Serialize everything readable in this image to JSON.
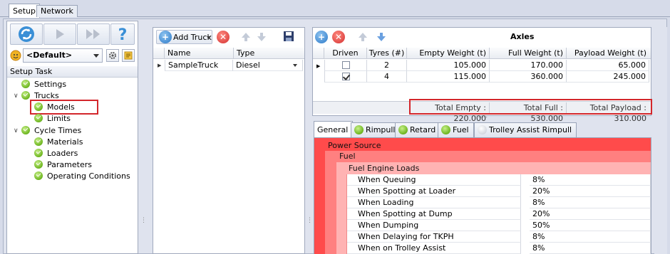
{
  "top_tabs": [
    "Setup",
    "Network"
  ],
  "profile": {
    "selected": "<Default>"
  },
  "setup_task": {
    "header": "Setup Task",
    "items": [
      {
        "label": "Settings",
        "level": 1
      },
      {
        "label": "Trucks",
        "level": 0,
        "expanded": true
      },
      {
        "label": "Models",
        "level": 1,
        "selected": true
      },
      {
        "label": "Limits",
        "level": 1
      },
      {
        "label": "Cycle Times",
        "level": 0,
        "expanded": true
      },
      {
        "label": "Materials",
        "level": 1
      },
      {
        "label": "Loaders",
        "level": 1
      },
      {
        "label": "Parameters",
        "level": 1
      },
      {
        "label": "Operating Conditions",
        "level": 1
      }
    ]
  },
  "trucks": {
    "add_label": "Add Truck",
    "columns": [
      "Name",
      "Type"
    ],
    "rows": [
      {
        "name": "SampleTruck",
        "type": "Diesel"
      }
    ]
  },
  "axles": {
    "title": "Axles",
    "columns": [
      "Driven",
      "Tyres (#)",
      "Empty Weight (t)",
      "Full Weight (t)",
      "Payload Weight (t)"
    ],
    "rows": [
      {
        "driven": false,
        "tyres": "2",
        "empty": "105.000",
        "full": "170.000",
        "payload": "65.000"
      },
      {
        "driven": true,
        "tyres": "4",
        "empty": "115.000",
        "full": "360.000",
        "payload": "245.000"
      }
    ],
    "totals": {
      "empty": "Total Empty : 220.000",
      "full": "Total Full : 530.000",
      "payload": "Total Payload : 310.000"
    }
  },
  "detail_tabs": [
    "General",
    "Rimpull",
    "Retard",
    "Fuel",
    "Trolley Assist Rimpull"
  ],
  "properties": {
    "group1": "Power Source",
    "group2": "Fuel",
    "group3": "Fuel Engine Loads",
    "rows": [
      {
        "label": "When Queuing",
        "value": "8%"
      },
      {
        "label": "When Spotting at Loader",
        "value": "20%"
      },
      {
        "label": "When Loading",
        "value": "8%"
      },
      {
        "label": "When Spotting at Dump",
        "value": "20%"
      },
      {
        "label": "When Dumping",
        "value": "50%"
      },
      {
        "label": "When Delaying for TKPH",
        "value": "8%"
      },
      {
        "label": "When on Trolley Assist",
        "value": "8%"
      }
    ]
  },
  "colors": {
    "accent_red": "#ff4b4b",
    "selection_border": "#d3262b",
    "check_green": "#6cb51e"
  }
}
